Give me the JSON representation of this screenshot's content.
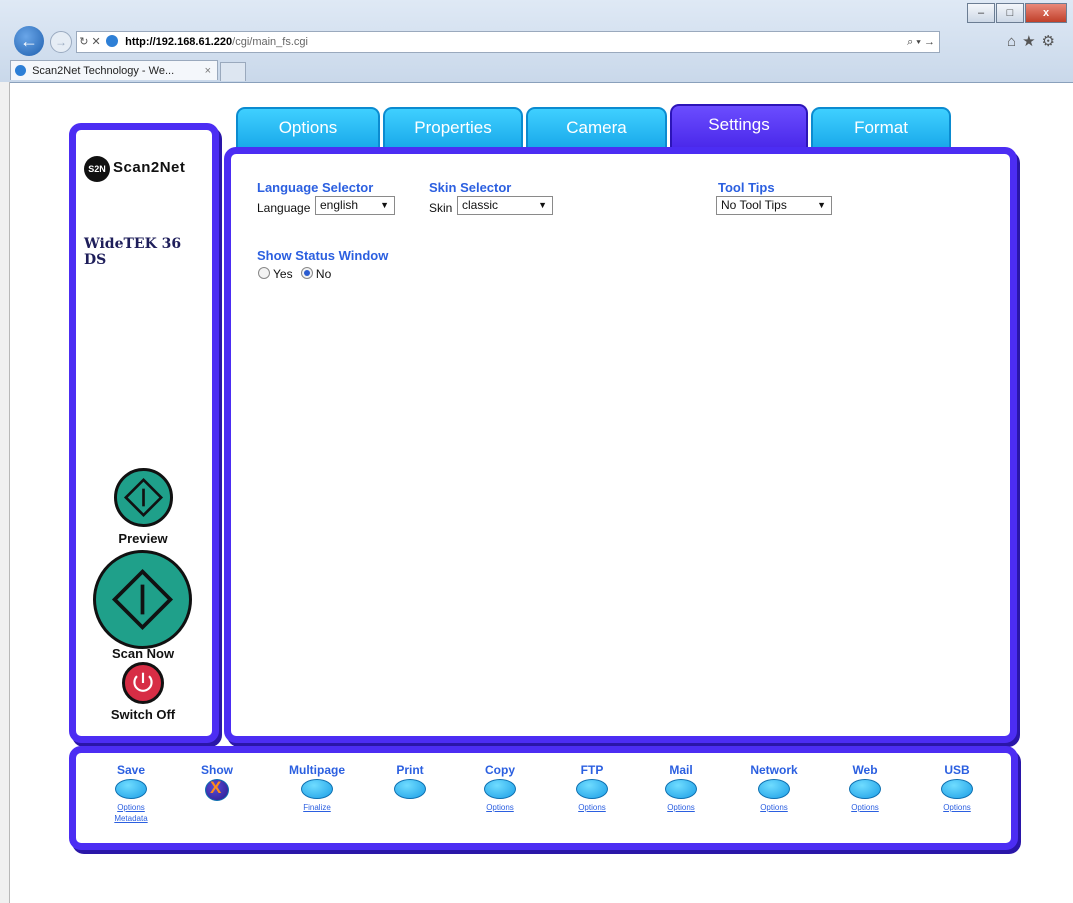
{
  "browser": {
    "url_host": "http://192.168.61.220",
    "url_path": "/cgi/main_fs.cgi",
    "tab_title": "Scan2Net Technology - We...",
    "window_controls": [
      "minimize",
      "maximize",
      "close"
    ]
  },
  "tabs": [
    {
      "label": "Options",
      "active": false
    },
    {
      "label": "Properties",
      "active": false
    },
    {
      "label": "Camera",
      "active": false
    },
    {
      "label": "Settings",
      "active": true
    },
    {
      "label": "Format",
      "active": false
    }
  ],
  "sidebar": {
    "logo_badge": "S2N",
    "logo_text": "Scan2Net",
    "model": "WideTEK 36 DS",
    "preview_label": "Preview",
    "scan_label": "Scan Now",
    "switch_off_label": "Switch Off"
  },
  "settings": {
    "language": {
      "title": "Language Selector",
      "label": "Language",
      "value": "english"
    },
    "skin": {
      "title": "Skin Selector",
      "label": "Skin",
      "value": "classic"
    },
    "tooltips": {
      "title": "Tool Tips",
      "value": "No Tool Tips"
    },
    "status_window": {
      "title": "Show Status Window",
      "yes_label": "Yes",
      "no_label": "No",
      "selected": "No"
    }
  },
  "bottom_bar": [
    {
      "label": "Save",
      "links": [
        "Options",
        "Metadata"
      ]
    },
    {
      "label": "Show",
      "links": []
    },
    {
      "label": "Multipage",
      "links": [
        "Finalize"
      ]
    },
    {
      "label": "Print",
      "links": []
    },
    {
      "label": "Copy",
      "links": [
        "Options"
      ]
    },
    {
      "label": "FTP",
      "links": [
        "Options"
      ]
    },
    {
      "label": "Mail",
      "links": [
        "Options"
      ]
    },
    {
      "label": "Network",
      "links": [
        "Options"
      ]
    },
    {
      "label": "Web",
      "links": [
        "Options"
      ]
    },
    {
      "label": "USB",
      "links": [
        "Options"
      ]
    }
  ],
  "colors": {
    "frame": "#4c2df3",
    "tab": "#19a8ea",
    "active_tab": "#4a28ea",
    "accent_text": "#2b5fe0",
    "scan_button": "#1fa08a",
    "off_button": "#d72d45"
  }
}
